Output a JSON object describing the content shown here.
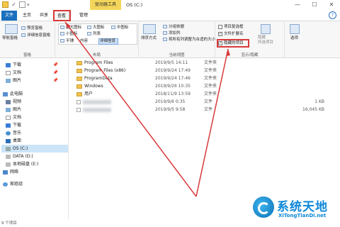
{
  "titlebar": {
    "context_tab": "驱动器工具",
    "title": "OS (C:)",
    "min": "—",
    "max": "☐",
    "close": "✕"
  },
  "tabs": {
    "file": "文件",
    "home": "主页",
    "share": "共享",
    "view": "查看",
    "manage": "管理",
    "help": "?"
  },
  "ribbon": {
    "pane_group": {
      "nav_pane": "导航窗格",
      "preview_pane": "预览窗格",
      "details_pane": "详细信息窗格",
      "label": "窗格"
    },
    "layout_group": {
      "items": [
        "超大图标",
        "大图标",
        "中图标",
        "小图标",
        "列表",
        "详细信息",
        "平铺",
        "内容"
      ],
      "label": "布局"
    },
    "current_view_group": {
      "sort_by": "排序方式",
      "group_by": "分组依据",
      "add_columns": "添加列",
      "size_all_columns": "将所有列调整为合适的大小",
      "label": "当前视图"
    },
    "show_hide_group": {
      "item_checkboxes": "项目复选框",
      "file_extensions": "文件扩展名",
      "hidden_items": "隐藏的项目",
      "hide_selected": "隐藏\n所选项目",
      "label": "显示/隐藏"
    },
    "options": "选项"
  },
  "sidebar": {
    "items": [
      {
        "label": "下载",
        "pinned": true
      },
      {
        "label": "文档",
        "pinned": true
      },
      {
        "label": "图片",
        "pinned": true
      },
      {
        "label": "此电脑",
        "pinned": false
      },
      {
        "label": "视频",
        "pinned": false
      },
      {
        "label": "图片",
        "pinned": false
      },
      {
        "label": "文档",
        "pinned": false
      },
      {
        "label": "下载",
        "pinned": false
      },
      {
        "label": "音乐",
        "pinned": false
      },
      {
        "label": "桌面",
        "pinned": false
      },
      {
        "label": "OS (C:)",
        "pinned": false
      },
      {
        "label": "DATA (D:)",
        "pinned": false
      },
      {
        "label": "本地磁盘 (E:)",
        "pinned": false
      },
      {
        "label": "网络",
        "pinned": false
      },
      {
        "label": "家庭组",
        "pinned": false
      }
    ]
  },
  "files": [
    {
      "name": "Program Files",
      "date": "2019/9/5 14:11",
      "type": "文件夹",
      "size": ""
    },
    {
      "name": "Program Files (x86)",
      "date": "2019/9/24 17:49",
      "type": "文件夹",
      "size": ""
    },
    {
      "name": "ProgramData",
      "date": "2019/9/24 17:46",
      "type": "文件夹",
      "size": ""
    },
    {
      "name": "Windows",
      "date": "2019/9/26 10:35",
      "type": "文件夹",
      "size": ""
    },
    {
      "name": "用户",
      "date": "2018/11/9 13:59",
      "type": "文件夹",
      "size": ""
    },
    {
      "name": "",
      "date": "2019/9/6 0:35",
      "type": "文件",
      "size": "1 KB"
    },
    {
      "name": "",
      "date": "2019/9/5 9:58",
      "type": "文件",
      "size": "16,045 KB"
    }
  ],
  "status": {
    "item_count": "9 个项目"
  },
  "watermark": {
    "brand": "系统天地",
    "url": "XiTongTianDi.net"
  },
  "colors": {
    "file_tab": "#1a6fbd",
    "context_tab": "#f3d659",
    "highlight": "#d83a3a",
    "selected_nav": "#cce4f7",
    "watermark": "#0e88d8"
  }
}
